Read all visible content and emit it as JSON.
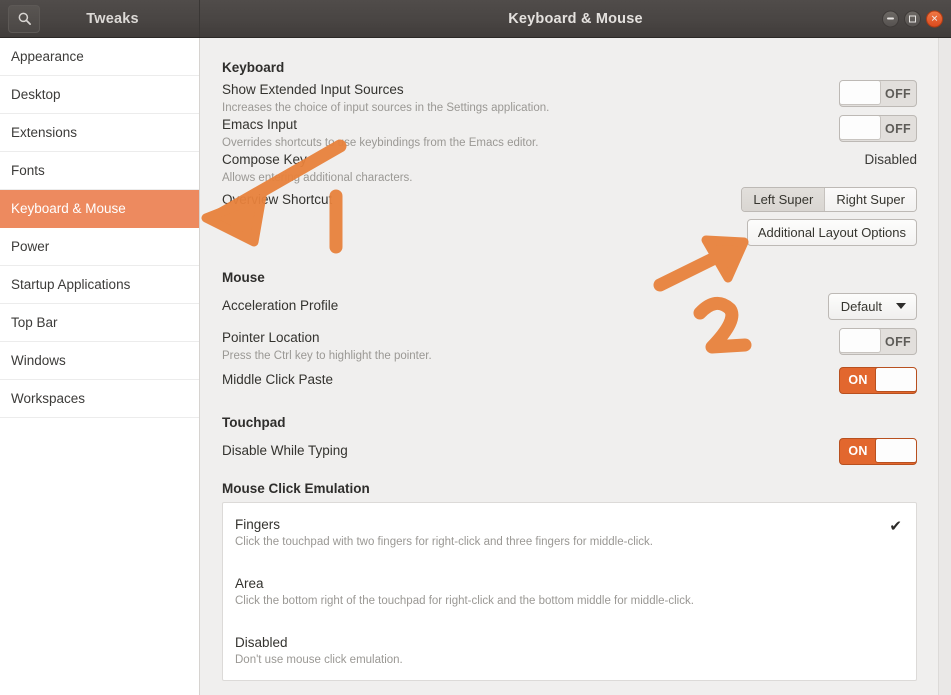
{
  "window": {
    "app_title": "Tweaks",
    "page_title": "Keyboard & Mouse",
    "search_icon": "search-icon",
    "minimize_label": "Minimize",
    "maximize_label": "Maximize",
    "close_label": "Close"
  },
  "sidebar": {
    "items": [
      {
        "label": "Appearance",
        "active": false
      },
      {
        "label": "Desktop",
        "active": false
      },
      {
        "label": "Extensions",
        "active": false
      },
      {
        "label": "Fonts",
        "active": false
      },
      {
        "label": "Keyboard & Mouse",
        "active": true
      },
      {
        "label": "Power",
        "active": false
      },
      {
        "label": "Startup Applications",
        "active": false
      },
      {
        "label": "Top Bar",
        "active": false
      },
      {
        "label": "Windows",
        "active": false
      },
      {
        "label": "Workspaces",
        "active": false
      }
    ]
  },
  "keyboard": {
    "heading": "Keyboard",
    "show_extended_input_sources": {
      "label": "Show Extended Input Sources",
      "description": "Increases the choice of input sources in the Settings application.",
      "state": "OFF"
    },
    "emacs_input": {
      "label": "Emacs Input",
      "description": "Overrides shortcuts to use keybindings from the Emacs editor.",
      "state": "OFF"
    },
    "compose_key": {
      "label": "Compose Key",
      "description": "Allows entering additional characters.",
      "value": "Disabled"
    },
    "overview_shortcut": {
      "label": "Overview Shortcut",
      "options": [
        "Left Super",
        "Right Super"
      ],
      "selected": "Left Super"
    },
    "additional_layout_options_label": "Additional Layout Options"
  },
  "mouse": {
    "heading": "Mouse",
    "acceleration_profile": {
      "label": "Acceleration Profile",
      "value": "Default"
    },
    "pointer_location": {
      "label": "Pointer Location",
      "description": "Press the Ctrl key to highlight the pointer.",
      "state": "OFF"
    },
    "middle_click_paste": {
      "label": "Middle Click Paste",
      "state": "ON"
    }
  },
  "touchpad": {
    "heading": "Touchpad",
    "disable_while_typing": {
      "label": "Disable While Typing",
      "state": "ON"
    }
  },
  "mouse_click_emulation": {
    "heading": "Mouse Click Emulation",
    "options": [
      {
        "title": "Fingers",
        "description": "Click the touchpad with two fingers for right-click and three fingers for middle-click.",
        "selected": true,
        "check_glyph": "✔"
      },
      {
        "title": "Area",
        "description": "Click the bottom right of the touchpad for right-click and the bottom middle for middle-click.",
        "selected": false,
        "check_glyph": ""
      },
      {
        "title": "Disabled",
        "description": "Don't use mouse click emulation.",
        "selected": false,
        "check_glyph": ""
      }
    ]
  },
  "annotations": {
    "color": "#e8823c",
    "marks": [
      {
        "id": "arrow-1",
        "label": "1",
        "target": "sidebar-item-keyboard-mouse"
      },
      {
        "id": "arrow-2",
        "label": "2",
        "target": "additional-layout-options-button"
      }
    ]
  },
  "colors": {
    "accent_orange": "#ed8a5f",
    "toggle_on": "#e2672e",
    "titlebar": "#494543",
    "content_bg": "#f0efee",
    "annotation": "#e8823c"
  }
}
